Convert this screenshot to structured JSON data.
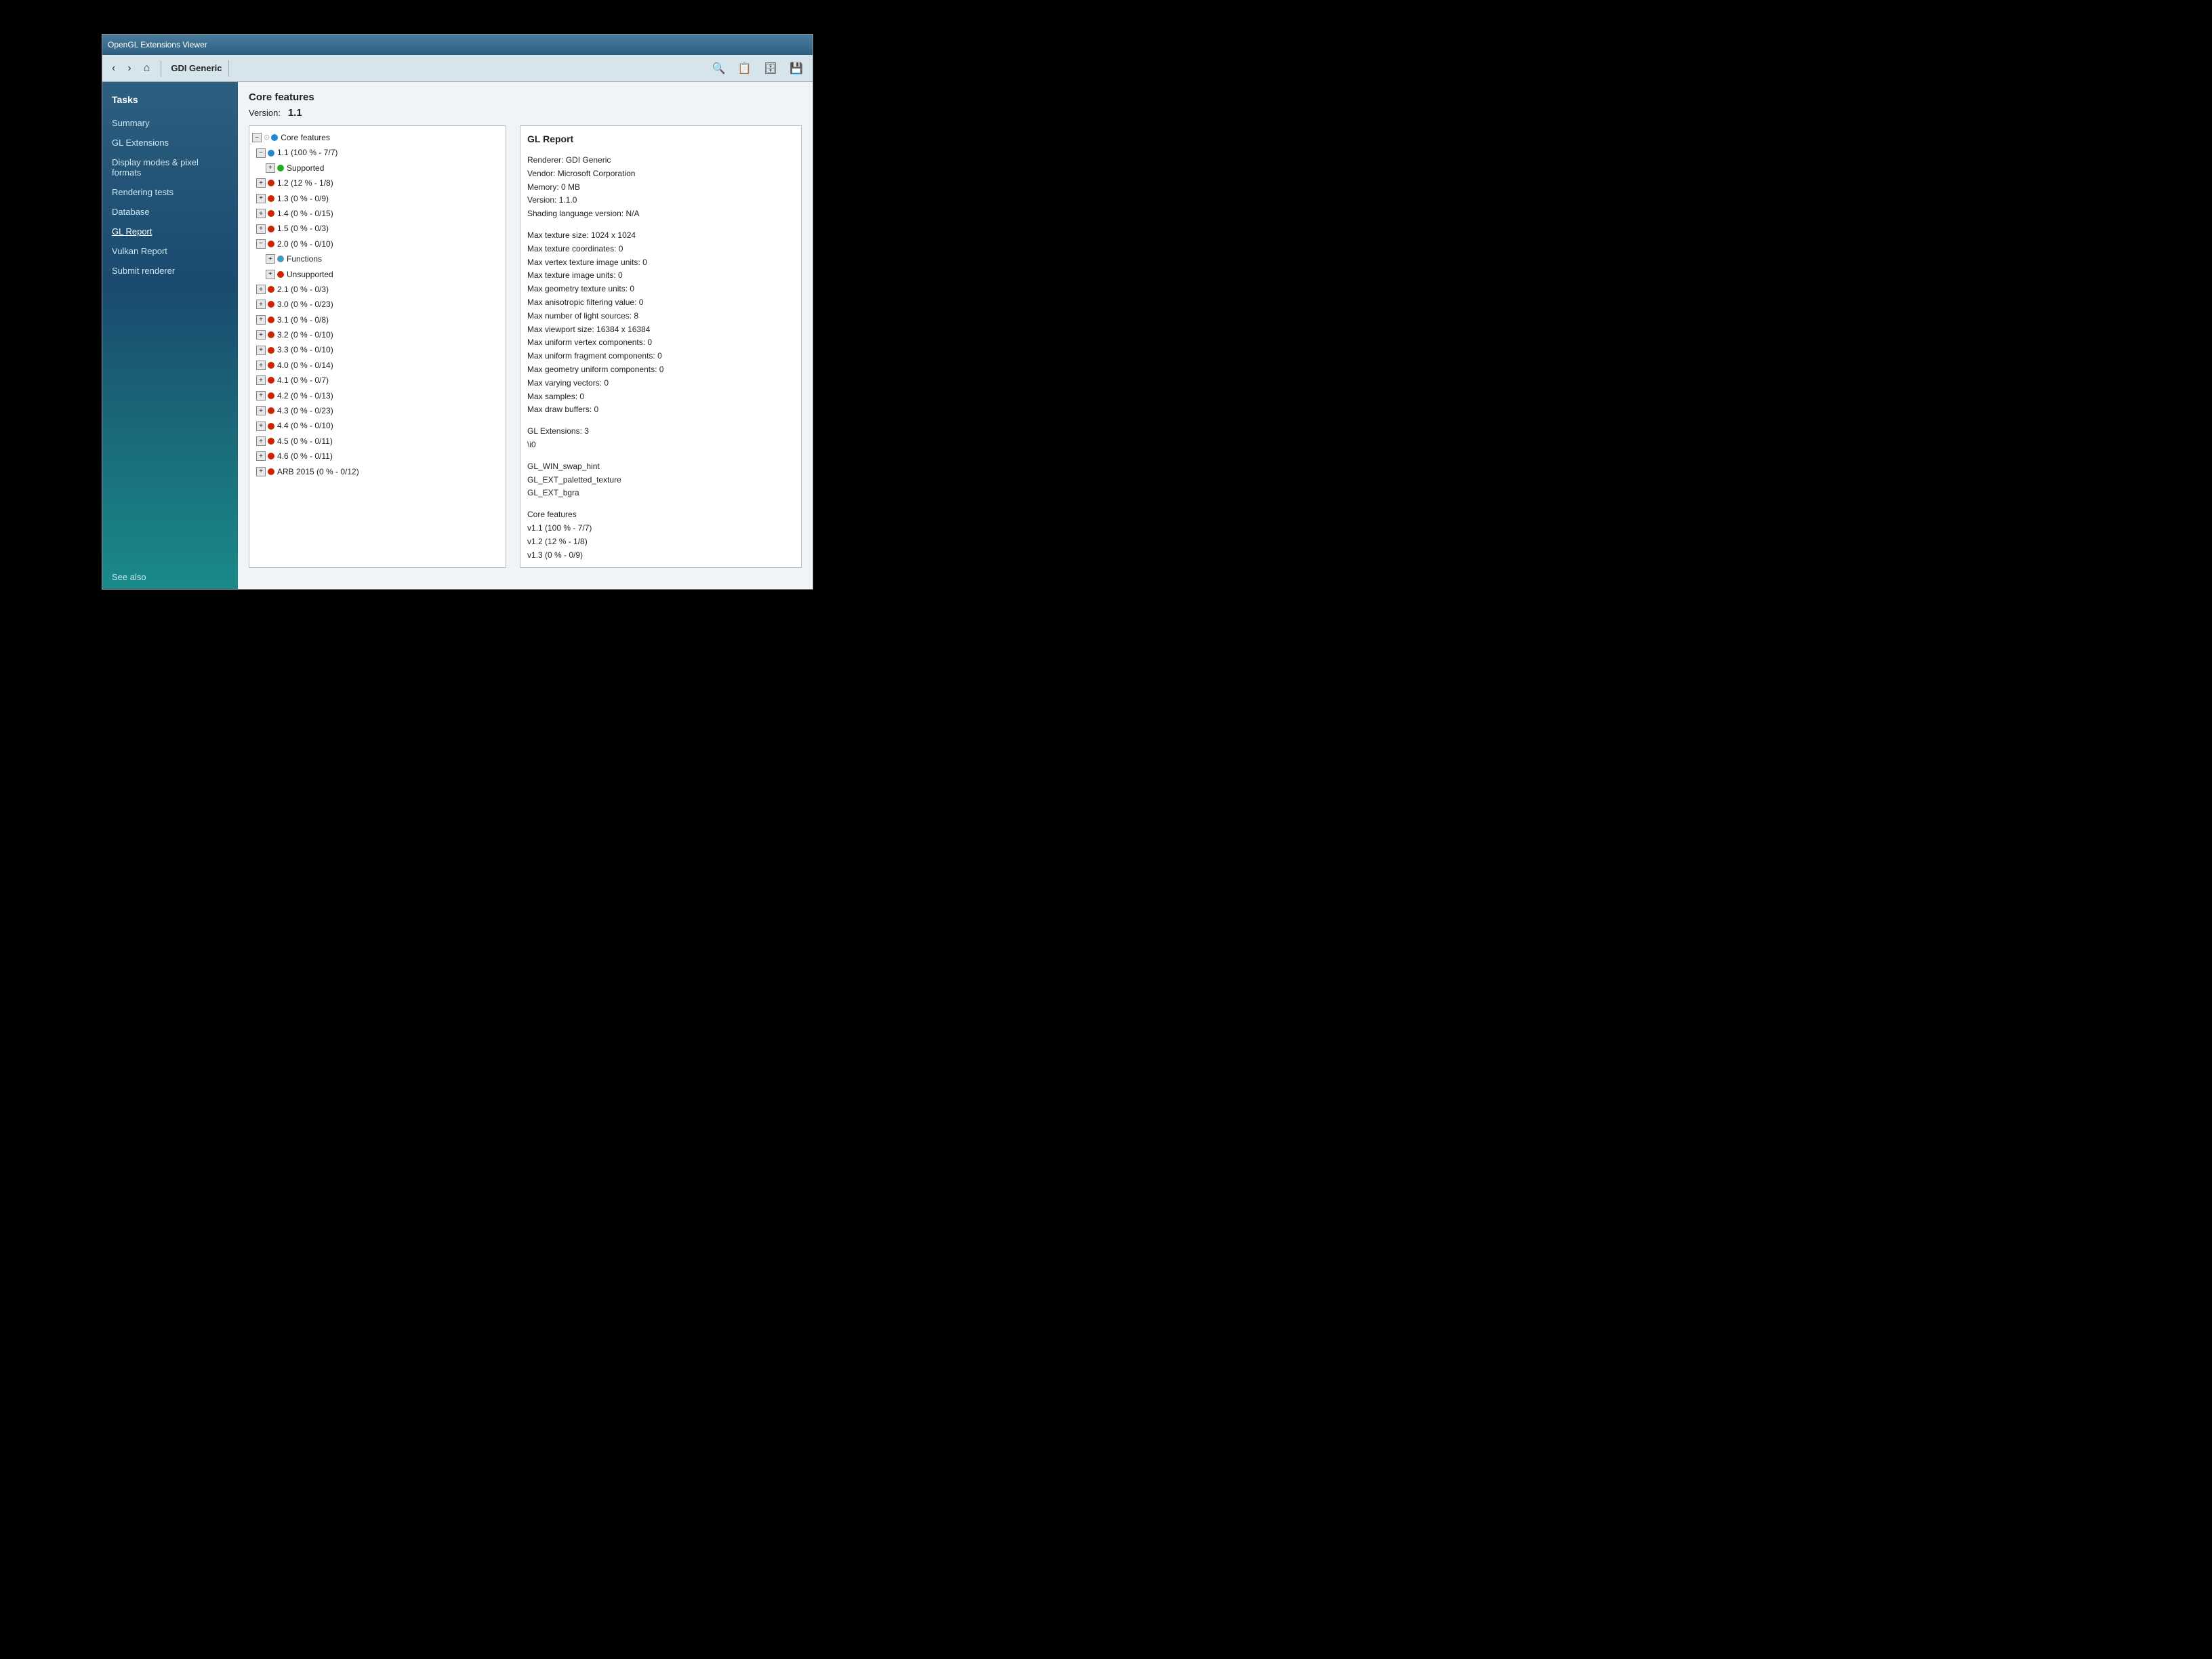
{
  "window": {
    "title": "OpenGL Extensions Viewer"
  },
  "toolbar": {
    "back_label": "‹",
    "forward_label": "›",
    "home_label": "⌂",
    "renderer_label": "GDI Generic",
    "search_icon": "🔍",
    "copy_icon": "📋",
    "db_icon": "🗄",
    "save_icon": "💾"
  },
  "sidebar": {
    "section_title": "Tasks",
    "items": [
      {
        "label": "Summary",
        "active": false
      },
      {
        "label": "GL Extensions",
        "active": false
      },
      {
        "label": "Display modes & pixel formats",
        "active": false
      },
      {
        "label": "Rendering tests",
        "active": false
      },
      {
        "label": "Database",
        "active": false
      },
      {
        "label": "GL Report",
        "active": true
      },
      {
        "label": "Vulkan Report",
        "active": false
      },
      {
        "label": "Submit renderer",
        "active": false
      }
    ],
    "footer": "See also"
  },
  "content": {
    "header": "Core features",
    "version_label": "Version:",
    "version_value": "1.1",
    "tree": [
      {
        "indent": 0,
        "expand": "−",
        "dot": "blue",
        "label": "Core features"
      },
      {
        "indent": 1,
        "expand": "−",
        "dot": "blue",
        "label": "1.1 (100 % - 7/7)"
      },
      {
        "indent": 2,
        "expand": "+",
        "dot": "green",
        "label": "Supported"
      },
      {
        "indent": 1,
        "expand": "+",
        "dot": "red",
        "label": "1.2 (12 % - 1/8)"
      },
      {
        "indent": 1,
        "expand": "+",
        "dot": "red",
        "label": "1.3 (0 % - 0/9)"
      },
      {
        "indent": 1,
        "expand": "+",
        "dot": "red",
        "label": "1.4 (0 % - 0/15)"
      },
      {
        "indent": 1,
        "expand": "+",
        "dot": "red",
        "label": "1.5 (0 % - 0/3)"
      },
      {
        "indent": 1,
        "expand": "−",
        "dot": "red",
        "label": "2.0 (0 % - 0/10)"
      },
      {
        "indent": 2,
        "expand": "+",
        "dot": "cyan",
        "label": "Functions"
      },
      {
        "indent": 2,
        "expand": "+",
        "dot": "red",
        "label": "Unsupported"
      },
      {
        "indent": 1,
        "expand": "+",
        "dot": "red",
        "label": "2.1 (0 % - 0/3)"
      },
      {
        "indent": 1,
        "expand": "+",
        "dot": "red",
        "label": "3.0 (0 % - 0/23)"
      },
      {
        "indent": 1,
        "expand": "+",
        "dot": "red",
        "label": "3.1 (0 % - 0/8)"
      },
      {
        "indent": 1,
        "expand": "+",
        "dot": "red",
        "label": "3.2 (0 % - 0/10)"
      },
      {
        "indent": 1,
        "expand": "+",
        "dot": "red",
        "label": "3.3 (0 % - 0/10)"
      },
      {
        "indent": 1,
        "expand": "+",
        "dot": "red",
        "label": "4.0 (0 % - 0/14)"
      },
      {
        "indent": 1,
        "expand": "+",
        "dot": "red",
        "label": "4.1 (0 % - 0/7)"
      },
      {
        "indent": 1,
        "expand": "+",
        "dot": "red",
        "label": "4.2 (0 % - 0/13)"
      },
      {
        "indent": 1,
        "expand": "+",
        "dot": "red",
        "label": "4.3 (0 % - 0/23)"
      },
      {
        "indent": 1,
        "expand": "+",
        "dot": "red",
        "label": "4.4 (0 % - 0/10)"
      },
      {
        "indent": 1,
        "expand": "+",
        "dot": "red",
        "label": "4.5 (0 % - 0/11)"
      },
      {
        "indent": 1,
        "expand": "+",
        "dot": "red",
        "label": "4.6 (0 % - 0/11)"
      },
      {
        "indent": 1,
        "expand": "+",
        "dot": "red",
        "label": "ARB 2015 (0 % - 0/12)"
      }
    ]
  },
  "gl_report": {
    "title": "GL Report",
    "renderer_info": [
      "Renderer: GDI Generic",
      "Vendor: Microsoft Corporation",
      "Memory: 0 MB",
      "Version: 1.1.0",
      "Shading language version: N/A"
    ],
    "texture_info": [
      "Max texture size: 1024 x 1024",
      "Max texture coordinates: 0",
      "Max vertex texture image units: 0",
      "Max texture image units: 0",
      "Max geometry texture units: 0",
      "Max anisotropic filtering value: 0",
      "Max number of light sources: 8",
      "Max viewport size: 16384 x 16384",
      "Max uniform vertex components: 0",
      "Max uniform fragment components: 0",
      "Max geometry uniform components: 0",
      "Max varying vectors: 0",
      "Max samples: 0",
      "Max draw buffers: 0"
    ],
    "extensions_info": [
      "GL Extensions: 3",
      "\\i0"
    ],
    "extension_list": [
      "GL_WIN_swap_hint",
      "GL_EXT_paletted_texture",
      "GL_EXT_bgra"
    ],
    "core_features_label": "Core features",
    "core_versions": [
      "v1.1 (100 % - 7/7)",
      "v1.2 (12 % - 1/8)",
      "v1.3 (0 % - 0/9)"
    ]
  }
}
